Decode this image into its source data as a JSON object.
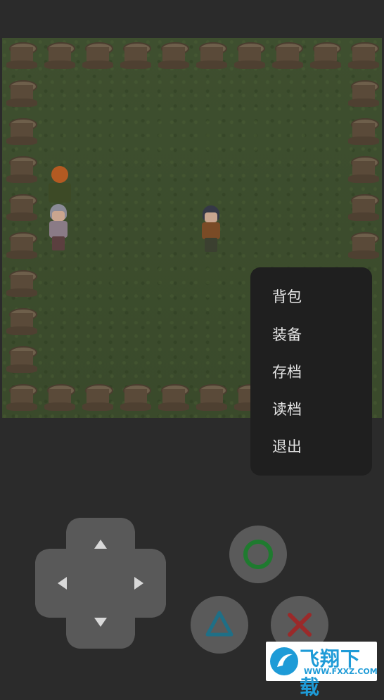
{
  "menu": {
    "items": [
      "背包",
      "装备",
      "存档",
      "读档",
      "退出"
    ]
  },
  "icons": {
    "dpad_up": "triangle-up-icon",
    "dpad_down": "triangle-down-icon",
    "dpad_left": "triangle-left-icon",
    "dpad_right": "triangle-right-icon",
    "circle_button": "circle-icon",
    "triangle_button": "triangle-icon",
    "cross_button": "cross-icon"
  },
  "colors": {
    "circle": "#1f7a2f",
    "triangle": "#1f6f86",
    "cross": "#9a2a2a"
  },
  "watermark": {
    "title": "飞翔下载",
    "subtitle": "WWW.FXXZ.COM"
  }
}
